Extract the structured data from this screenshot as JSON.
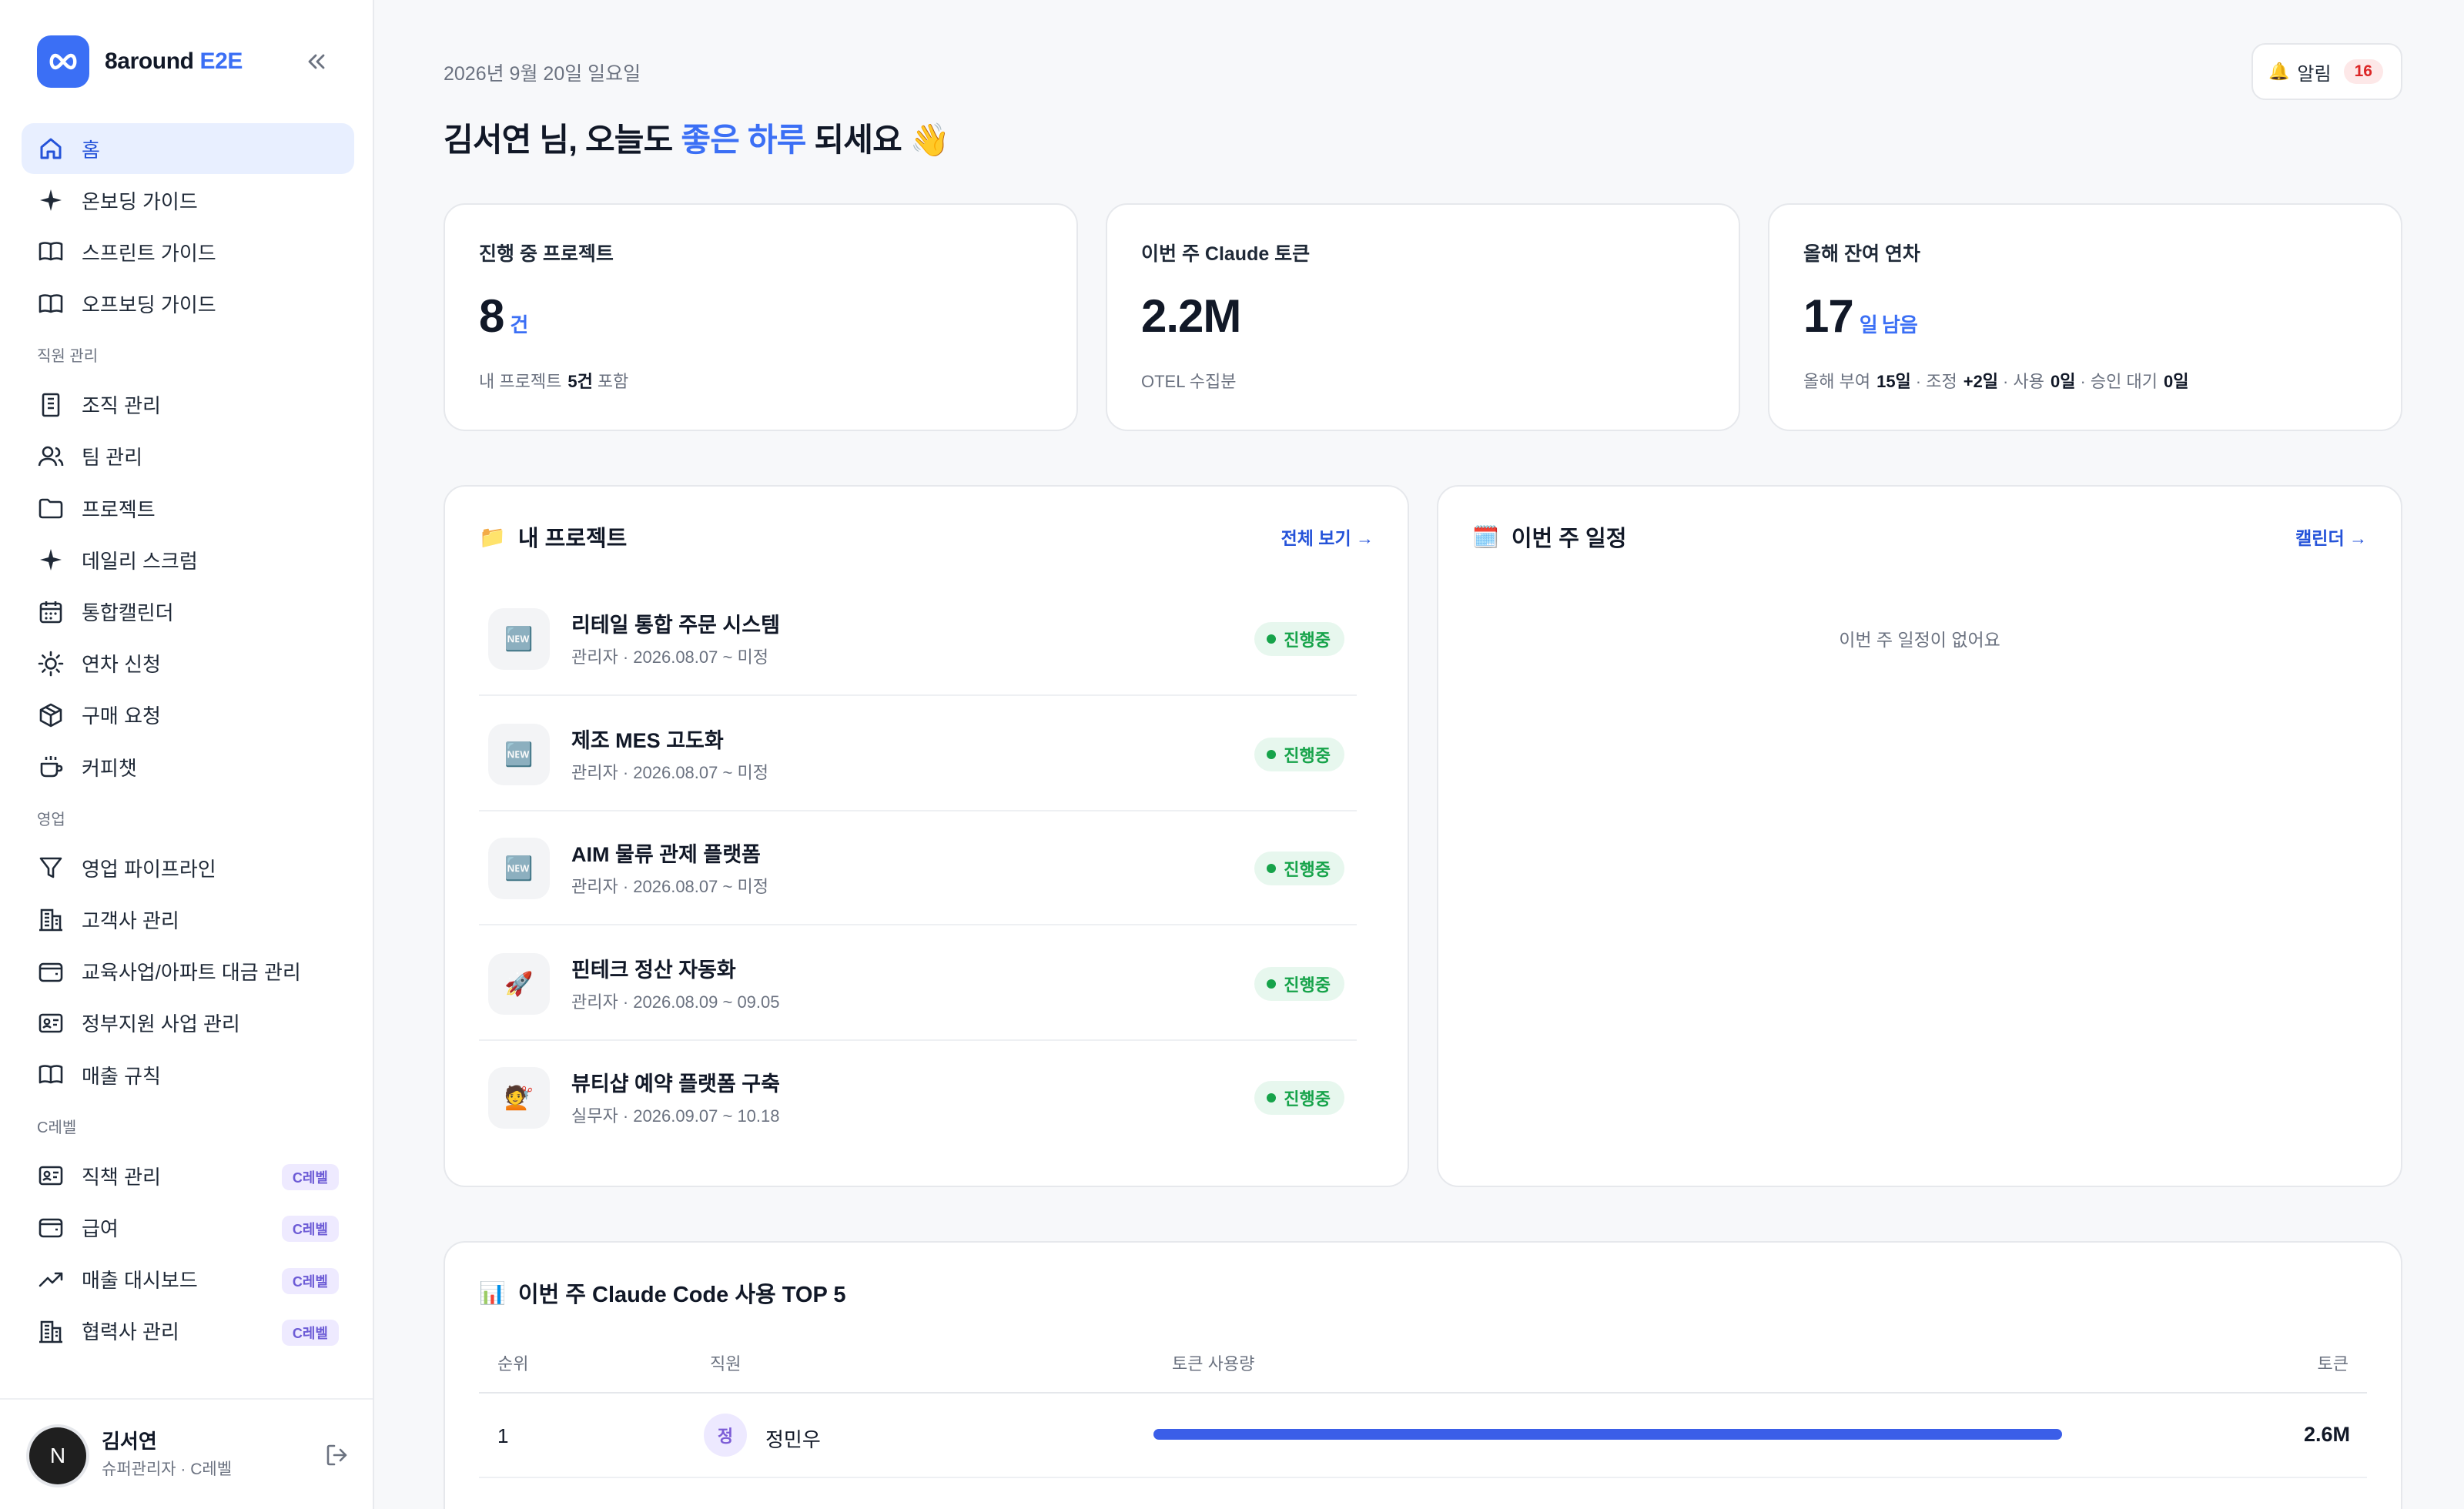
{
  "brand": {
    "name_main": "8around",
    "name_accent": "E2E"
  },
  "nav": {
    "items_top": [
      {
        "label": "홈",
        "icon": "home-icon",
        "active": true
      },
      {
        "label": "온보딩 가이드",
        "icon": "sparkle-icon"
      },
      {
        "label": "스프린트 가이드",
        "icon": "book-icon"
      },
      {
        "label": "오프보딩 가이드",
        "icon": "book-icon"
      }
    ],
    "section_hr": "직원 관리",
    "items_hr": [
      {
        "label": "조직 관리",
        "icon": "building-doc-icon"
      },
      {
        "label": "팀 관리",
        "icon": "users-icon"
      },
      {
        "label": "프로젝트",
        "icon": "folder-icon"
      },
      {
        "label": "데일리 스크럼",
        "icon": "sparkle-icon"
      },
      {
        "label": "통합캘린더",
        "icon": "calendar-icon"
      },
      {
        "label": "연차 신청",
        "icon": "sun-icon"
      },
      {
        "label": "구매 요청",
        "icon": "box-icon"
      },
      {
        "label": "커피챗",
        "icon": "coffee-icon"
      }
    ],
    "section_sales": "영업",
    "items_sales": [
      {
        "label": "영업 파이프라인",
        "icon": "filter-icon"
      },
      {
        "label": "고객사 관리",
        "icon": "office-building-icon"
      },
      {
        "label": "교육사업/아파트 대금 관리",
        "icon": "wallet-icon"
      },
      {
        "label": "정부지원 사업 관리",
        "icon": "id-card-icon"
      },
      {
        "label": "매출 규칙",
        "icon": "book-icon"
      }
    ],
    "section_c": "C레벨",
    "items_c": [
      {
        "label": "직책 관리",
        "icon": "id-card-icon",
        "badge": "C레벨"
      },
      {
        "label": "급여",
        "icon": "wallet-icon",
        "badge": "C레벨"
      },
      {
        "label": "매출 대시보드",
        "icon": "trend-icon",
        "badge": "C레벨"
      },
      {
        "label": "협력사 관리",
        "icon": "office-building-icon",
        "badge": "C레벨"
      }
    ]
  },
  "user": {
    "initial": "N",
    "name": "김서연",
    "role": "슈퍼관리자 · C레벨"
  },
  "header": {
    "date": "2026년 9월 20일 일요일",
    "greet_prefix": "김서연 님, 오늘도 ",
    "greet_highlight": "좋은 하루",
    "greet_suffix": " 되세요 👋",
    "alert_label": "알림",
    "alert_count": "16"
  },
  "stats": {
    "projects": {
      "title": "진행 중 프로젝트",
      "value": "8",
      "unit": "건",
      "sub_prefix": "내 프로젝트",
      "sub_value": "5건",
      "sub_suffix": "포함"
    },
    "tokens": {
      "title": "이번 주 Claude 토큰",
      "value": "2.2M",
      "sub": "OTEL 수집분"
    },
    "leave": {
      "title": "올해 잔여 연차",
      "value": "17",
      "unit": "일 남음",
      "l1": "올해 부여",
      "v1": "15일",
      "l2": "· 조정",
      "v2": "+2일",
      "l3": "· 사용",
      "v3": "0일",
      "l4": "· 승인 대기",
      "v4": "0일"
    }
  },
  "my_projects": {
    "title": "내 프로젝트",
    "link": "전체 보기 →",
    "rows": [
      {
        "icon": "🆕",
        "name": "리테일 통합 주문 시스템",
        "meta": "관리자 · 2026.08.07 ~ 미정",
        "status": "진행중"
      },
      {
        "icon": "🆕",
        "name": "제조 MES 고도화",
        "meta": "관리자 · 2026.08.07 ~ 미정",
        "status": "진행중"
      },
      {
        "icon": "🆕",
        "name": "AIM 물류 관제 플랫폼",
        "meta": "관리자 · 2026.08.07 ~ 미정",
        "status": "진행중"
      },
      {
        "icon": "🚀",
        "name": "핀테크 정산 자동화",
        "meta": "관리자 · 2026.08.09 ~ 09.05",
        "status": "진행중"
      },
      {
        "icon": "💇",
        "name": "뷰티샵 예약 플랫폼 구축",
        "meta": "실무자 · 2026.09.07 ~ 10.18",
        "status": "진행중"
      }
    ]
  },
  "schedule": {
    "title": "이번 주 일정",
    "link": "캘린더 →",
    "empty": "이번 주 일정이 없어요"
  },
  "top5": {
    "title": "이번 주 Claude Code 사용 TOP 5",
    "headers": {
      "rank": "순위",
      "employee": "직원",
      "usage": "토큰 사용량",
      "tokens": "토큰"
    },
    "rows": [
      {
        "rank": "1",
        "avatar": "정",
        "name": "정민우",
        "usage_fraction": 1.0,
        "tokens": "2.6M"
      }
    ]
  },
  "colors": {
    "accent": "#3b6ff5",
    "success": "#16a34a",
    "danger": "#dc2626"
  }
}
